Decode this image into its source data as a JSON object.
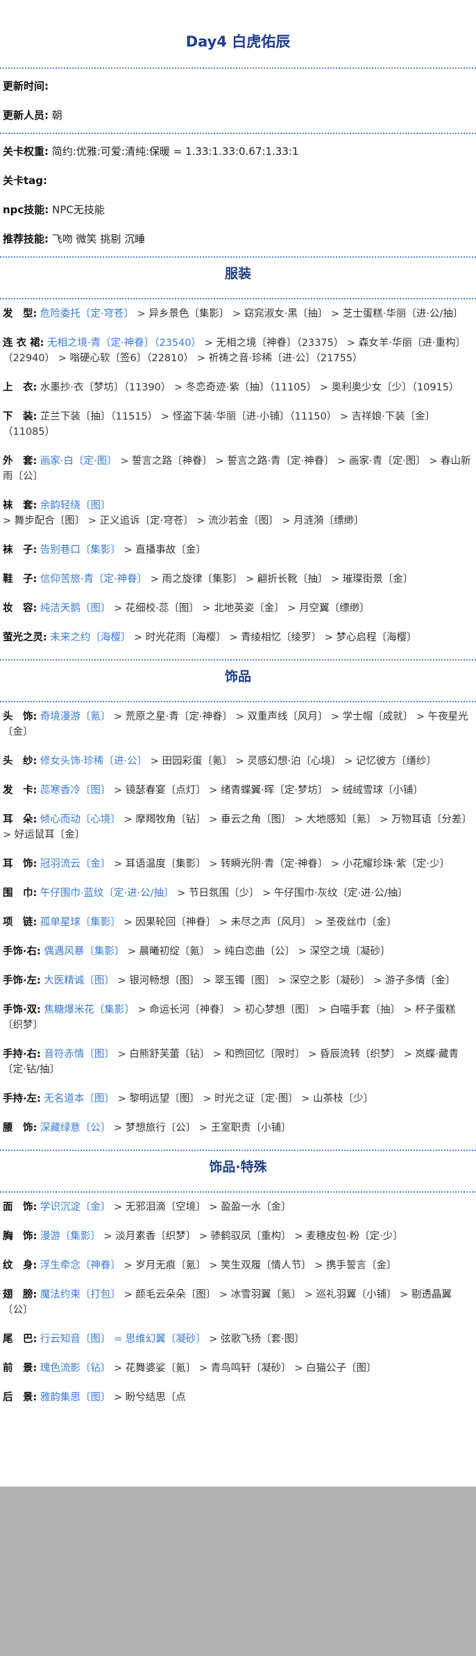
{
  "title": "Day4 白虎佑辰",
  "meta": {
    "update_time_label": "更新时间:",
    "update_time_value": "",
    "updater_label": "更新人员:",
    "updater_value": "朝"
  },
  "level": {
    "weight_label": "关卡权重:",
    "weight_value": "简约:优雅:可爱:清纯:保暖 = 1.33:1.33:0.67:1.33:1",
    "tag_label": "关卡tag:",
    "tag_value": "",
    "npc_label": "npc技能:",
    "npc_value": "NPC无技能",
    "skill_label": "推荐技能:",
    "skill_value": "飞吻 微笑 挑剔 沉睡"
  },
  "sections": [
    {
      "title": "服装",
      "rows": [
        {
          "label": "发　型:",
          "first": "危险委托〔定·穹苍〕",
          "rest": " > 异乡景色〔集影〕 > 窈窕淑女·黑〔抽〕 > 芝士蛋糕·华丽〔进·公/抽〕"
        },
        {
          "label": "连 衣 裙:",
          "first": "无相之境·青〔定·神眷〕（23540）",
          "rest": " > 无相之境〔神眷〕（23375） > 森女羊·华丽〔进·重构〕（22940） > 嗡硬心软〔签6〕（22810） > 祈祷之音·珍稀〔进·公〕（21755）"
        },
        {
          "label": "上　衣:",
          "first": "",
          "rest": "水墨抄·衣〔梦坊〕（11390） > 冬恋奇迹·紫〔抽〕（11105） > 奥利奥少女〔少〕（10915）"
        },
        {
          "label": "下　装:",
          "first": "",
          "rest": "芷兰下装〔抽〕（11515） > 怪盗下装·华丽〔进·小铺〕（11150） > 吉祥娘·下装〔金〕（11085）"
        },
        {
          "label": "外　套:",
          "first": "画家·白〔定·图〕",
          "rest": " > 誓言之路〔神眷〕 > 誓言之路·青〔定·神眷〕 > 画家·青〔定·图〕 > 春山新雨〔公〕"
        },
        {
          "label": "袜　套:",
          "first": "余韵轻绕〔图〕",
          "rest": " > 舞步配合〔图〕 > 正义追诉〔定·穹苍〕 > 流沙若金〔图〕 > 月涟漪〔缥缈〕"
        },
        {
          "label": "袜　子:",
          "first": "告别巷口〔集影〕",
          "rest": " > 直播事故〔金〕"
        },
        {
          "label": "鞋　子:",
          "first": "信仰苦旅·青〔定·神眷〕",
          "rest": " > 雨之旋律〔集影〕 > 翩折长靴〔抽〕 > 璀璨街景〔金〕"
        },
        {
          "label": "妆　容:",
          "first": "纯洁天鹅〔图〕",
          "rest": " > 花细校·蕊〔图〕 > 北地英姿〔金〕 > 月空翼〔缥缈〕"
        },
        {
          "label": "萤光之灵:",
          "first": "未来之约〔海樱〕",
          "rest": " > 时光花雨〔海樱〕 > 青绫相忆〔绫罗〕 > 梦心启程〔海樱〕"
        }
      ]
    },
    {
      "title": "饰品",
      "rows": [
        {
          "label": "头　饰:",
          "first": "奇境漫游〔氪〕",
          "rest": " > 荒原之星·青〔定·神眷〕 > 双重声线〔风月〕 > 学士帽〔成就〕 > 午夜星光〔金〕"
        },
        {
          "label": "头　纱:",
          "first": "修女头饰·珍稀〔进·公〕",
          "rest": " > 田园彩蛋〔氪〕 > 灵感幻想·泊〔心境〕 > 记忆彼方〔缮纱〕"
        },
        {
          "label": "发　卡:",
          "first": "蕊寒香冷〔图〕",
          "rest": " > 镜瑟春宴〔点灯〕 > 绪青蝶翼·晖〔定·梦坊〕 > 绒绒雪球〔小铺〕"
        },
        {
          "label": "耳　朵:",
          "first": "倾心而动〔心境〕",
          "rest": " > 摩羯牧角〔钻〕 > 垂云之角〔图〕 > 大地感知〔氪〕 > 万物耳语〔分差〕 > 好运鼠耳〔金〕"
        },
        {
          "label": "耳　饰:",
          "first": "冠羽流云〔金〕",
          "rest": " > 耳语温度〔集影〕 > 转瞬光阴·青〔定·神眷〕 > 小花耀珍珠·紫〔定·少〕"
        },
        {
          "label": "围　巾:",
          "first": "午仔围巾·蓝纹〔定·进·公/抽〕",
          "rest": " > 节日氛围〔少〕 > 午仔围巾·灰纹〔定·进·公/抽〕"
        },
        {
          "label": "项　链:",
          "first": "孤单星球〔集影〕",
          "rest": " > 因果轮回〔神眷〕 > 未尽之声〔风月〕 > 圣夜丝巾〔金〕"
        },
        {
          "label": "手饰·右:",
          "first": "偶遇风暴〔集影〕",
          "rest": " > 晨曦初绽〔氪〕 > 纯白恋曲〔公〕 > 深空之境〔凝砂〕"
        },
        {
          "label": "手饰·左:",
          "first": "大医精诚〔图〕",
          "rest": " > 银河畅想〔图〕 > 翠玉镯〔图〕 > 深空之影〔凝砂〕 > 游子多情〔金〕"
        },
        {
          "label": "手饰·双:",
          "first": "焦糖爆米花〔集影〕",
          "rest": " > 命运长河〔神眷〕 > 初心梦想〔图〕 > 白喵手套〔抽〕 > 杯子蛋糕〔织梦〕"
        },
        {
          "label": "手持·右:",
          "first": "音符赤情〔图〕",
          "rest": " > 白熊舒芙蕾〔钻〕 > 和煦回忆〔限时〕 > 昏辰流转〔织梦〕 > 岚蝶·藏青〔定·钻/抽〕"
        },
        {
          "label": "手持·左:",
          "first": "无名道本〔图〕",
          "rest": " > 黎明远望〔图〕 > 时光之证〔定·图〕 > 山茶枝〔少〕"
        },
        {
          "label": "腰　饰:",
          "first": "深藏绿意〔公〕",
          "rest": " > 梦想旅行〔公〕 > 王室职责〔小铺〕"
        }
      ]
    },
    {
      "title": "饰品·特殊",
      "rows": [
        {
          "label": "面　饰:",
          "first": "学识沉淀〔金〕",
          "rest": " > 无邪泪滴〔空境〕 > 盈盈一水〔金〕"
        },
        {
          "label": "胸　饰:",
          "first": "漫游〔集影〕",
          "rest": " > 淡月素香〔织梦〕 > 骖鹤驭凤〔重构〕 > 麦穗皮包·粉〔定·少〕"
        },
        {
          "label": "纹　身:",
          "first": "浮生牵念〔神眷〕",
          "rest": " > 岁月无痕〔氪〕 > 笑生双履〔情人节〕 > 携手誓言〔金〕"
        },
        {
          "label": "翅　膀:",
          "first": "魔法约束〔打包〕",
          "rest": " > 颜毛云朵朵〔图〕 > 冰雪羽翼〔氪〕 > 巡礼羽翼〔小铺〕 > 剔透晶翼〔公〕"
        },
        {
          "label": "尾　巴:",
          "first": "行云知音〔图〕 = 思维幻翼〔凝砂〕",
          "rest": " > 弦歌飞扬〔套·图〕"
        },
        {
          "label": "前　景:",
          "first": "瑰色流影〔钻〕",
          "rest": " > 花舞婆娑〔氪〕 > 青鸟鸣轩〔凝砂〕 > 白猫公子〔图〕"
        },
        {
          "label": "后　景:",
          "first": "雅韵集思〔图〕",
          "rest": " > 盼兮结思〔点"
        }
      ]
    }
  ]
}
